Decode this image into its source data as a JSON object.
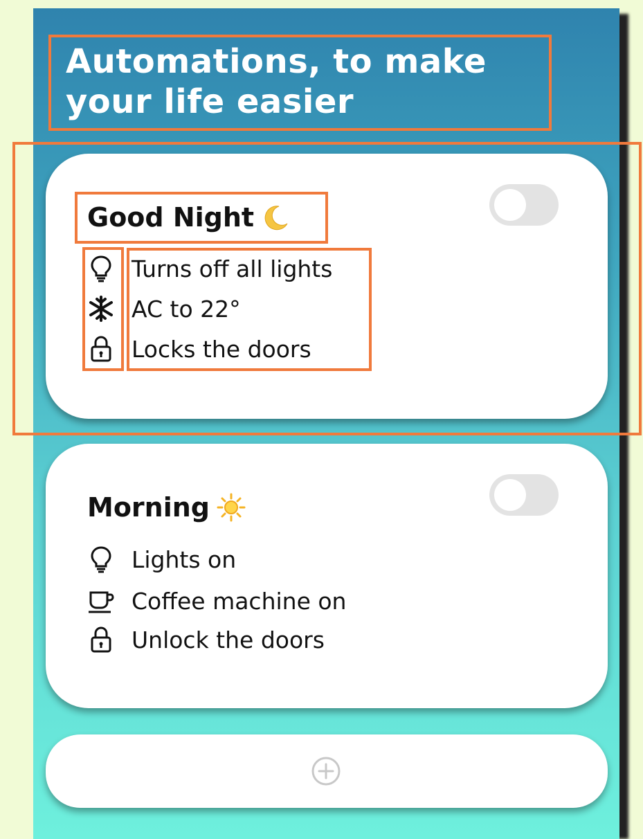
{
  "heading": "Automations, to make your life easier",
  "cards": [
    {
      "title": "Good Night",
      "title_icon": "moon-icon",
      "enabled": false,
      "items": [
        {
          "icon": "lightbulb-icon",
          "text": "Turns off all lights"
        },
        {
          "icon": "snowflake-icon",
          "text": "AC to 22°"
        },
        {
          "icon": "lock-icon",
          "text": "Locks the doors"
        }
      ]
    },
    {
      "title": "Morning",
      "title_icon": "sun-icon",
      "enabled": false,
      "items": [
        {
          "icon": "lightbulb-icon",
          "text": "Lights on"
        },
        {
          "icon": "coffee-cup-icon",
          "text": "Coffee machine on"
        },
        {
          "icon": "lock-icon",
          "text": "Unlock the doors"
        }
      ]
    }
  ],
  "add_button_icon": "plus-circle-icon",
  "colors": {
    "page_background": "#f1fbd6",
    "gradient_top": "#2f83ae",
    "gradient_bottom": "#6ef0dd",
    "highlight": "#f07a3c",
    "toggle_off": "#e3e3e3"
  }
}
